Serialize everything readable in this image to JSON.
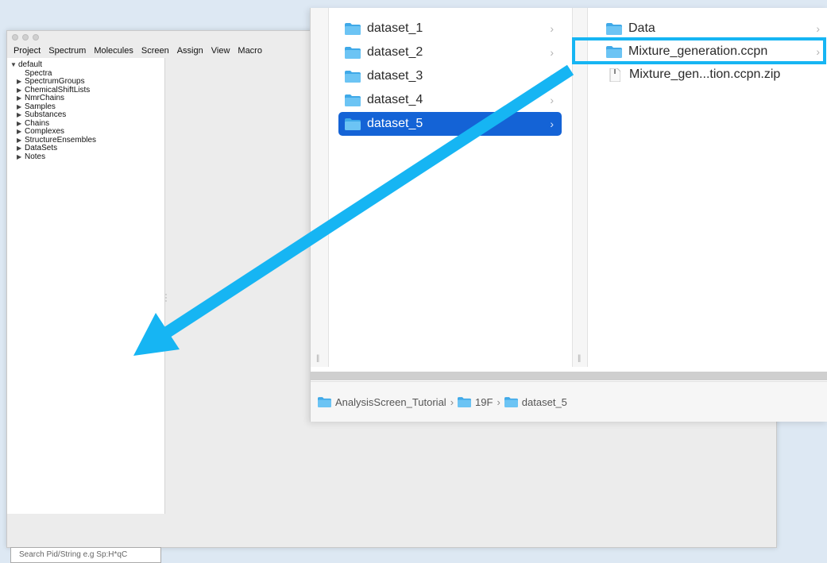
{
  "menubar": [
    "Project",
    "Spectrum",
    "Molecules",
    "Screen",
    "Assign",
    "View",
    "Macro"
  ],
  "tree": {
    "root": "default",
    "items": [
      {
        "label": "Spectra",
        "expandable": false
      },
      {
        "label": "SpectrumGroups",
        "expandable": true
      },
      {
        "label": "ChemicalShiftLists",
        "expandable": true
      },
      {
        "label": "NmrChains",
        "expandable": true
      },
      {
        "label": "Samples",
        "expandable": true
      },
      {
        "label": "Substances",
        "expandable": true
      },
      {
        "label": "Chains",
        "expandable": true
      },
      {
        "label": "Complexes",
        "expandable": true
      },
      {
        "label": "StructureEnsembles",
        "expandable": true
      },
      {
        "label": "DataSets",
        "expandable": true
      },
      {
        "label": "Notes",
        "expandable": true
      }
    ]
  },
  "search": {
    "placeholder": "Search Pid/String e.g Sp:H*qC"
  },
  "finder": {
    "column1": [
      {
        "label": "dataset_1",
        "selected": false
      },
      {
        "label": "dataset_2",
        "selected": false
      },
      {
        "label": "dataset_3",
        "selected": false
      },
      {
        "label": "dataset_4",
        "selected": false
      },
      {
        "label": "dataset_5",
        "selected": true
      }
    ],
    "column2": [
      {
        "label": "Data",
        "type": "folder"
      },
      {
        "label": "Mixture_generation.ccpn",
        "type": "folder"
      },
      {
        "label": "Mixture_gen...tion.ccpn.zip",
        "type": "file"
      }
    ],
    "path": [
      "AnalysisScreen_Tutorial",
      "19F",
      "dataset_5"
    ]
  },
  "colors": {
    "selection": "#1463d6",
    "annotation": "#16b5f3",
    "folder": "#3fa9e8"
  }
}
